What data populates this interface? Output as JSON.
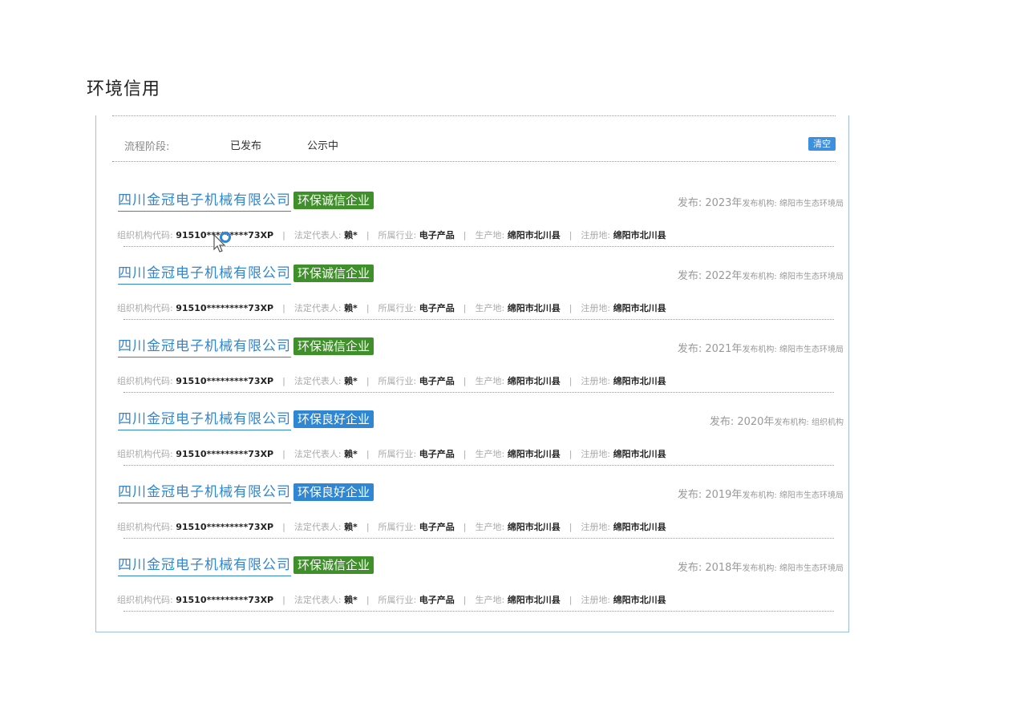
{
  "page_title": "环境信用",
  "filter": {
    "label": "流程阶段:",
    "options": [
      "已发布",
      "公示中"
    ],
    "clear_label": "清空"
  },
  "field_labels": {
    "org_code": "组织机构代码:",
    "legal_rep": "法定代表人:",
    "industry": "所属行业:",
    "production_place": "生产地:",
    "registered_place": "注册地:"
  },
  "records": [
    {
      "company": "四川金冠电子机械有限公司",
      "badge": "环保诚信企业",
      "badge_color": "#3f8f2a",
      "publish_prefix": "发布:",
      "year": "2023年",
      "agency": "发布机构: 绵阳市生态环境局",
      "org_code": "91510*********73XP",
      "legal_rep": "赖*",
      "industry": "电子产品",
      "production_place": "绵阳市北川县",
      "registered_place": "绵阳市北川县"
    },
    {
      "company": "四川金冠电子机械有限公司",
      "badge": "环保诚信企业",
      "badge_color": "#3f8f2a",
      "publish_prefix": "发布:",
      "year": "2022年",
      "agency": "发布机构: 绵阳市生态环境局",
      "org_code": "91510*********73XP",
      "legal_rep": "赖*",
      "industry": "电子产品",
      "production_place": "绵阳市北川县",
      "registered_place": "绵阳市北川县"
    },
    {
      "company": "四川金冠电子机械有限公司",
      "badge": "环保诚信企业",
      "badge_color": "#3f8f2a",
      "publish_prefix": "发布:",
      "year": "2021年",
      "agency": "发布机构: 绵阳市生态环境局",
      "org_code": "91510*********73XP",
      "legal_rep": "赖*",
      "industry": "电子产品",
      "production_place": "绵阳市北川县",
      "registered_place": "绵阳市北川县"
    },
    {
      "company": "四川金冠电子机械有限公司",
      "badge": "环保良好企业",
      "badge_color": "#2f86d3",
      "publish_prefix": "发布:",
      "year": "2020年",
      "agency": "发布机构: 组织机构",
      "org_code": "91510*********73XP",
      "legal_rep": "赖*",
      "industry": "电子产品",
      "production_place": "绵阳市北川县",
      "registered_place": "绵阳市北川县"
    },
    {
      "company": "四川金冠电子机械有限公司",
      "badge": "环保良好企业",
      "badge_color": "#2f86d3",
      "publish_prefix": "发布:",
      "year": "2019年",
      "agency": "发布机构: 绵阳市生态环境局",
      "org_code": "91510*********73XP",
      "legal_rep": "赖*",
      "industry": "电子产品",
      "production_place": "绵阳市北川县",
      "registered_place": "绵阳市北川县"
    },
    {
      "company": "四川金冠电子机械有限公司",
      "badge": "环保诚信企业",
      "badge_color": "#3f8f2a",
      "publish_prefix": "发布:",
      "year": "2018年",
      "agency": "发布机构: 绵阳市生态环境局",
      "org_code": "91510*********73XP",
      "legal_rep": "赖*",
      "industry": "电子产品",
      "production_place": "绵阳市北川县",
      "registered_place": "绵阳市北川县"
    }
  ]
}
